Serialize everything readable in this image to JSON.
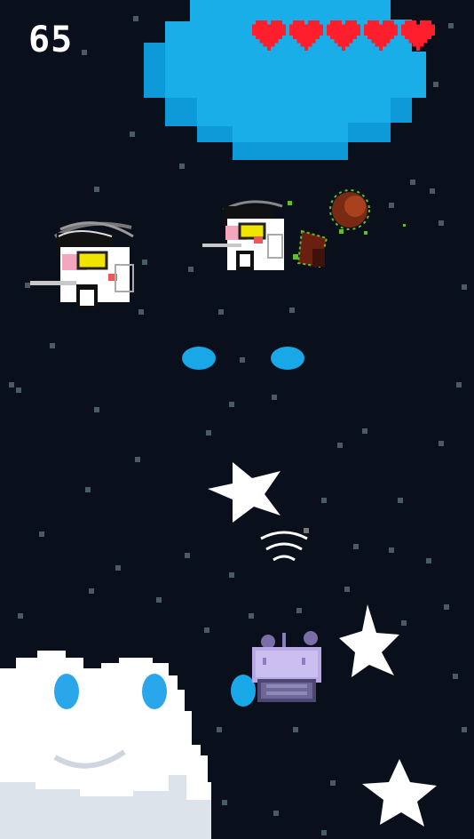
{
  "hud": {
    "score": "65",
    "lives": 5,
    "heart_color": "#ff1e2b"
  },
  "colors": {
    "space": "#0a0f1c",
    "blue_blob": "#1aaee8",
    "blue_blob_edge": "#0e9ad8",
    "bullet": "#18a8e8",
    "cloud": "#ffffff",
    "cloud_eye": "#29a7ea",
    "ship": "#b8a9e6",
    "star": "#ffffff"
  },
  "sprites": {
    "enemies": [
      "spamton-enemy",
      "spamton-enemy"
    ],
    "player": "purple-pod-ship",
    "boss": "blue-pixel-blob",
    "cloud": "smiling-cloud",
    "explosion": "debris-explosion",
    "signal": "wifi-signal-icon"
  }
}
